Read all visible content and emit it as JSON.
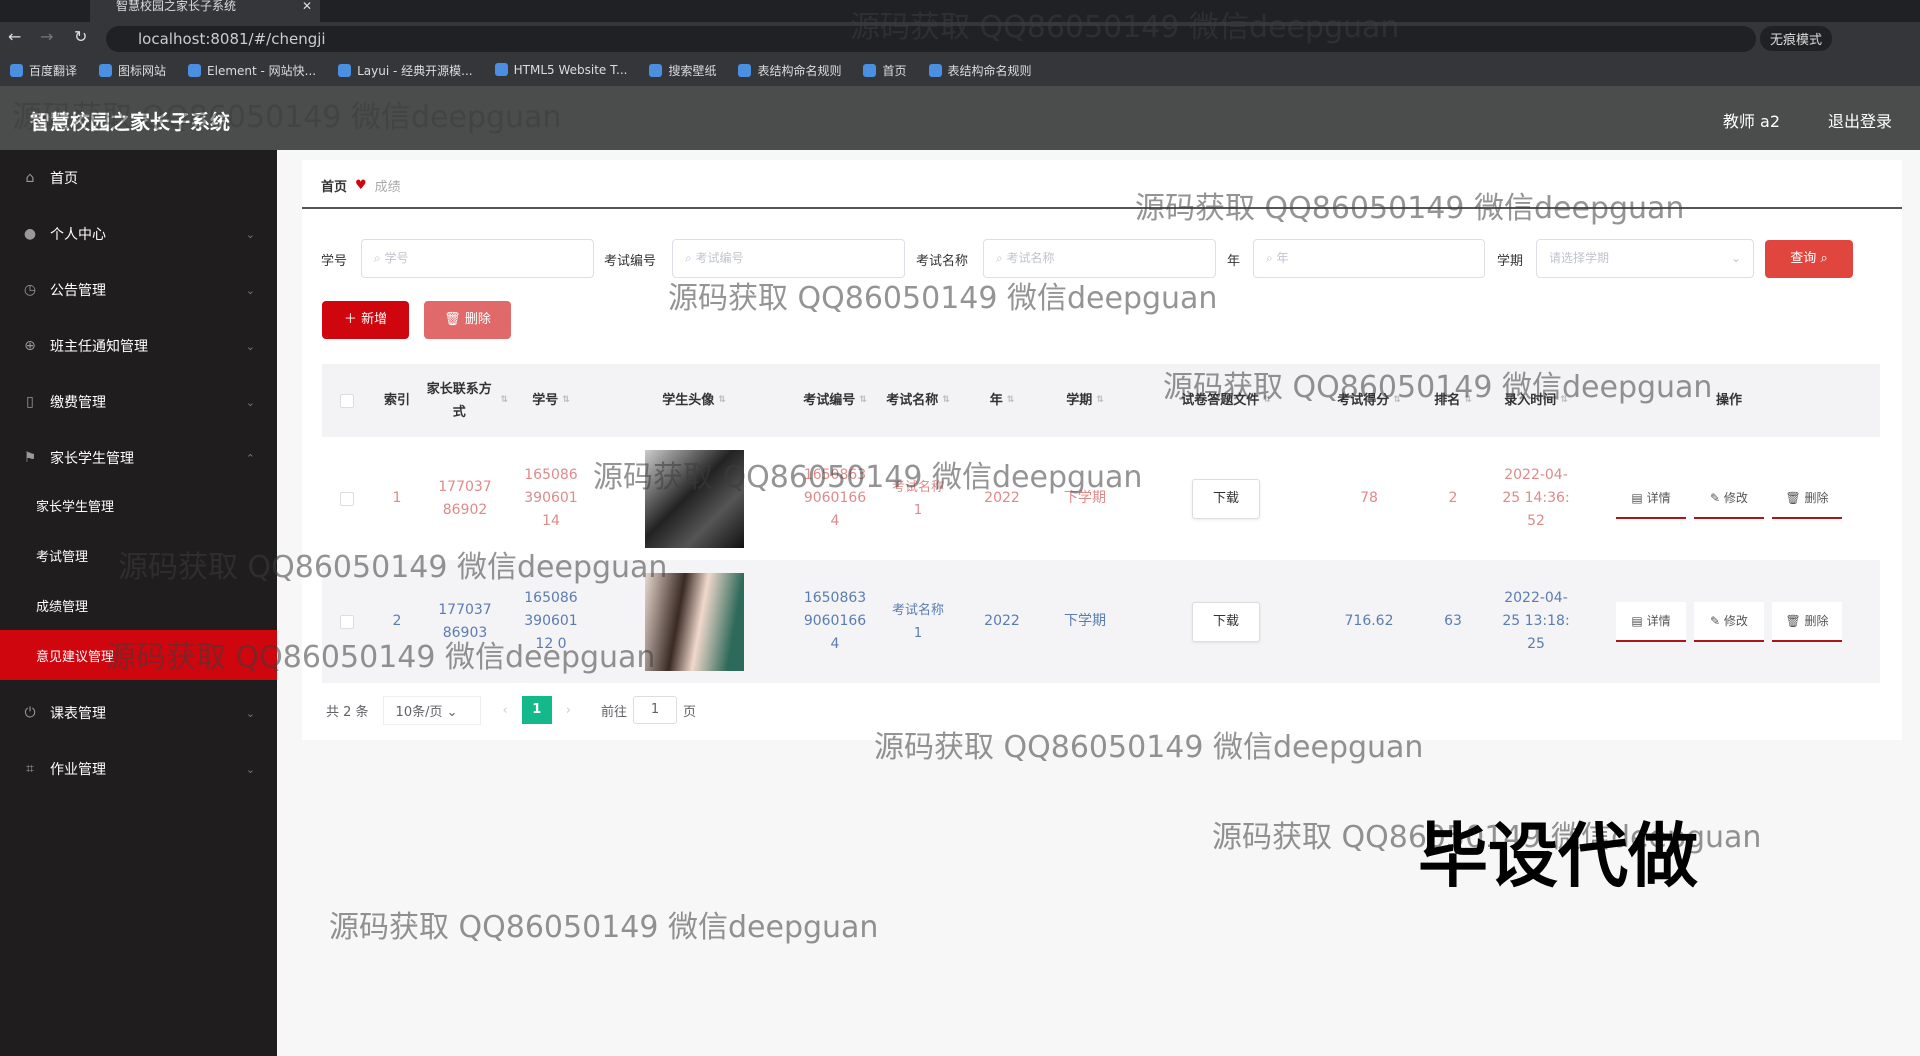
{
  "browser": {
    "tab_title": "智慧校园之家长子系统",
    "url": "localhost:8081/#/chengji",
    "incognito": "无痕模式",
    "bookmarks": [
      "百度翻译",
      "图标网站",
      "Element - 网站快...",
      "Layui - 经典开源模...",
      "HTML5 Website T...",
      "搜索壁纸",
      "表结构命名规则",
      "首页",
      "表结构命名规则"
    ]
  },
  "header": {
    "title": "智慧校园之家长子系统",
    "user": "教师 a2",
    "logout": "退出登录"
  },
  "sidebar": {
    "items": [
      {
        "label": "首页",
        "icon": "home-icon"
      },
      {
        "label": "个人中心",
        "icon": "user-icon"
      },
      {
        "label": "公告管理",
        "icon": "clock-icon"
      },
      {
        "label": "班主任通知管理",
        "icon": "target-icon"
      },
      {
        "label": "缴费管理",
        "icon": "mic-icon"
      },
      {
        "label": "家长学生管理",
        "icon": "flag-icon"
      }
    ],
    "sub": [
      "家长学生管理",
      "考试管理",
      "成绩管理",
      "意见建议管理"
    ],
    "after": [
      {
        "label": "课表管理",
        "icon": "power-icon"
      },
      {
        "label": "作业管理",
        "icon": "crop-icon"
      }
    ]
  },
  "breadcrumb": {
    "home": "首页",
    "current": "成绩"
  },
  "search": {
    "xh_label": "学号",
    "xh_ph": "学号",
    "ksbh_label": "考试编号",
    "ksbh_ph": "考试编号",
    "ksmc_label": "考试名称",
    "ksmc_ph": "考试名称",
    "year_label": "年",
    "year_ph": "年",
    "xq_label": "学期",
    "xq_ph": "请选择学期",
    "query": "查询"
  },
  "actions": {
    "add": "新增",
    "delete": "删除"
  },
  "table": {
    "headers": [
      "索引",
      "家长联系方式",
      "学号",
      "学生头像",
      "考试编号",
      "考试名称",
      "年",
      "学期",
      "试卷答题文件",
      "考试得分",
      "排名",
      "录入时间",
      "操作"
    ],
    "rows": [
      {
        "index": "1",
        "phone": "17703786902",
        "xh": "16508639060114",
        "ksbh": "16508639060166 4",
        "ksmc": "考试名称1",
        "year": "2022",
        "xq": "下学期",
        "file": "下载",
        "score": "78",
        "rank": "2",
        "time": "2022-04-25 14:36:52"
      },
      {
        "index": "2",
        "phone": "17703786903",
        "xh": "16508639060112 0",
        "ksbh": "16508639060166 4",
        "ksmc": "考试名称1",
        "year": "2022",
        "xq": "下学期",
        "file": "下载",
        "score": "716.62",
        "rank": "63",
        "time": "2022-04-25 13:18:25"
      }
    ],
    "ops": {
      "detail": "详情",
      "edit": "修改",
      "delete": "删除"
    }
  },
  "pagination": {
    "total": "共 2 条",
    "size": "10条/页",
    "page": "1",
    "goto": "前往",
    "goto_val": "1",
    "page_suffix": "页"
  },
  "watermark": "源码获取 QQ86050149 微信deepguan",
  "stamp": "毕设代做",
  "colors": {
    "accent": "#d0060f",
    "row1_text": "#e08a8a",
    "row2_text": "#5a7db0",
    "page_active": "#13b98a"
  }
}
